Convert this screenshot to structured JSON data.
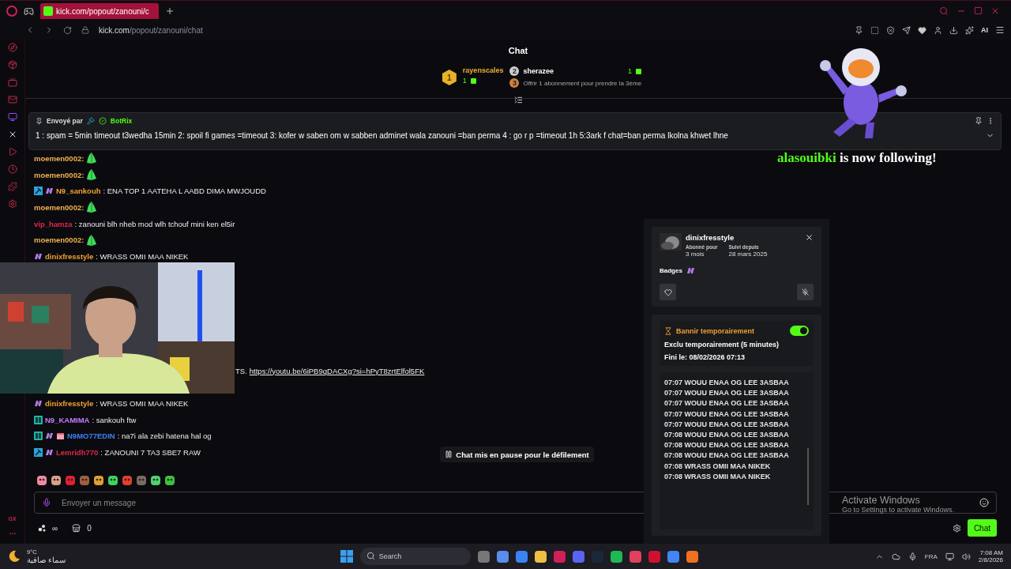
{
  "browser": {
    "tab": {
      "title": "kick.com/popout/zanouni/c",
      "selected": true
    },
    "url": {
      "host": "kick.com",
      "path": "/popout/zanouni/chat"
    },
    "toolbar_label": "AI",
    "sidebar_label": "GX"
  },
  "chat": {
    "title": "Chat",
    "leaderboard": {
      "first": {
        "rank": "1",
        "name": "rayenscales",
        "count": "1"
      },
      "second": {
        "rank": "2",
        "name": "sherazee",
        "count": "1"
      },
      "offer": {
        "rank": "3",
        "text": "Offrir 1 abonnement pour prendre la 3ème"
      }
    },
    "pinned": {
      "label": "Envoyé par",
      "sender": "BotRix",
      "text": "1 : spam = 5min timeout t3wedha 15min 2: spoil fi games =timeout 3: kofer w saben om w sabben adminet wala zanouni =ban perma 4 : go r p =timeout 1h 5:3ark f chat=ban perma lkolna khwet lhne"
    },
    "messages": [
      {
        "kind": "emote",
        "user": "moemen0002:",
        "color": "#f2b24e"
      },
      {
        "kind": "emote",
        "user": "moemen0002:",
        "color": "#f2b24e"
      },
      {
        "kind": "message",
        "badges": [
          {
            "kind": "mod"
          },
          {
            "kind": "sub"
          }
        ],
        "user": "N9_sankouh",
        "color": "#f0a030",
        "text": ": ENA TOP 1 AATEHA L AABD DIMA MWJOUDD"
      },
      {
        "kind": "emote",
        "user": "moemen0002:",
        "color": "#f2b24e"
      },
      {
        "kind": "message",
        "user": "vip_hamza",
        "color": "#e0284a",
        "text": ": zanouni blh nheb mod wlh tchouf mini ken el5ir"
      },
      {
        "kind": "emote",
        "user": "moemen0002:",
        "color": "#f2b24e"
      },
      {
        "kind": "message",
        "badges": [
          {
            "kind": "sub"
          }
        ],
        "user": "dinixfresstyle",
        "color": "#f0a030",
        "text": ": WRASS OMII MAA NIKEK"
      },
      {
        "kind": "link",
        "prefix": "TS.",
        "link": "https://youtu.be/6iPB9qDACXg?si=hPyT8zrtElfol5FK"
      },
      {
        "kind": "message",
        "badges": [
          {
            "kind": "sub"
          }
        ],
        "user": "dinixfresstyle",
        "color": "#f0a030",
        "text": ": WRASS OMII MAA NIKEK"
      },
      {
        "kind": "message",
        "badges": [
          {
            "kind": "og"
          }
        ],
        "user": "N9_KAMIMA",
        "color": "#c77dff",
        "text": ": sankouh ftw"
      },
      {
        "kind": "message",
        "badges": [
          {
            "kind": "og"
          },
          {
            "kind": "sub"
          },
          {
            "kind": "gift"
          }
        ],
        "user": "N9MO77EDIN",
        "color": "#3b82f6",
        "text": ": na7i ala zebi hatena hal og"
      },
      {
        "kind": "message",
        "badges": [
          {
            "kind": "mod"
          },
          {
            "kind": "sub"
          }
        ],
        "user": "Lemridh770",
        "color": "#e0284a",
        "text": ": ZANOUNI 7 TA3 SBE7 RAW"
      }
    ],
    "paused_notice": "Chat mis en pause pour le défilement",
    "input": {
      "placeholder": "Envoyer un message"
    },
    "footer": {
      "points": "∞",
      "store_count": "0",
      "send_label": "Chat"
    }
  },
  "follow_alert": {
    "user": "alasouibki",
    "text": "is now following!"
  },
  "user_card": {
    "name": "dinixfresstyle",
    "stats": [
      {
        "label": "Abonné pour",
        "value": "3 mois"
      },
      {
        "label": "Suivi depuis",
        "value": "28 mars 2025"
      }
    ],
    "badges_label": "Badges",
    "action": {
      "label": "Bannir temporairement",
      "on": true
    },
    "status": "Exclu temporairement (5 minutes)",
    "ends": "Fini le: 08/02/2026 07:13",
    "history": [
      "07:07 WOUU ENAA OG LEE 3ASBAA",
      "07:07 WOUU ENAA OG LEE 3ASBAA",
      "07:07 WOUU ENAA OG LEE 3ASBAA",
      "07:07 WOUU ENAA OG LEE 3ASBAA",
      "07:07 WOUU ENAA OG LEE 3ASBAA",
      "07:08 WOUU ENAA OG LEE 3ASBAA",
      "07:08 WOUU ENAA OG LEE 3ASBAA",
      "07:08 WOUU ENAA OG LEE 3ASBAA",
      "07:08 WRASS OMII MAA NIKEK",
      "07:08 WRASS OMII MAA NIKEK"
    ]
  },
  "activation": {
    "title": "Activate Windows",
    "subtitle": "Go to Settings to activate Windows."
  },
  "taskbar": {
    "weather": {
      "temp": "9°C",
      "condition": "سماء صافية"
    },
    "search": {
      "placeholder": "Search"
    },
    "language": "FRA",
    "time": "7:08 AM",
    "date": "2/8/2026"
  }
}
